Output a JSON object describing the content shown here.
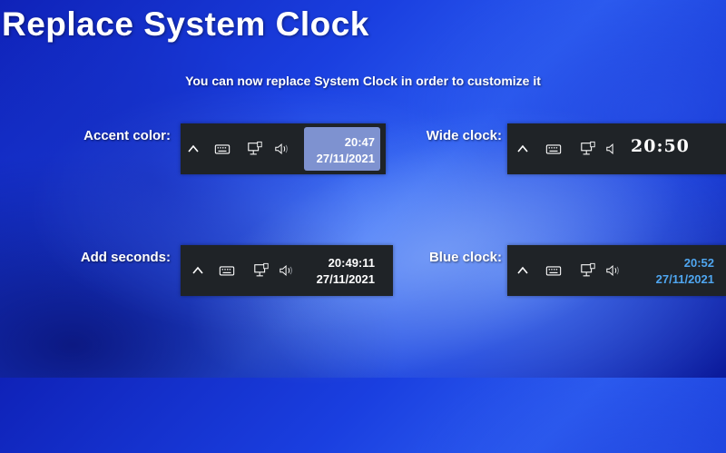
{
  "header": {
    "title": "Replace System Clock",
    "subtitle": "You can now replace System Clock in order to customize it"
  },
  "examples": {
    "accent": {
      "label": "Accent color:",
      "time": "20:47",
      "date": "27/11/2021",
      "accent_color": "#7e92d0"
    },
    "wide": {
      "label": "Wide clock:",
      "time": "20:50"
    },
    "seconds": {
      "label": "Add seconds:",
      "time": "20:49:11",
      "date": "27/11/2021"
    },
    "blue": {
      "label": "Blue clock:",
      "time": "20:52",
      "date": "27/11/2021",
      "clock_color": "#4fa6f0"
    }
  },
  "tray_icons": [
    "chevron-up-icon",
    "keyboard-icon",
    "network-icon",
    "volume-icon"
  ],
  "colors": {
    "taskbar": "#1f2327",
    "background": "#1a3fe0"
  }
}
